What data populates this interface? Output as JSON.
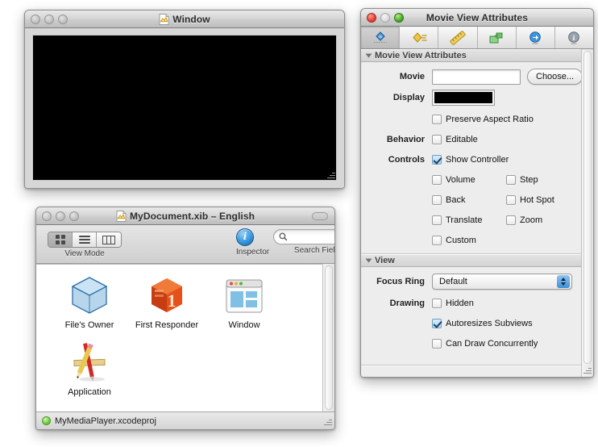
{
  "windows": {
    "canvas_window": {
      "title": "Window",
      "title_icon": "nib-document-icon",
      "content_color": "#000000",
      "traffic_lights": [
        "close-gray",
        "minimize-gray",
        "zoom-gray"
      ]
    },
    "xib_window": {
      "title": "MyDocument.xib – English",
      "title_icon": "nib-document-icon",
      "toolbar": {
        "view_mode_label": "View Mode",
        "view_mode_options": [
          "icon-view",
          "list-view",
          "column-view"
        ],
        "view_mode_selected": "icon-view",
        "inspector_label": "Inspector",
        "inspector_icon": "info-circle-icon",
        "search_label": "Search Field",
        "search_placeholder": "",
        "search_value": "",
        "search_icon": "search-icon"
      },
      "objects": [
        {
          "label": "File's Owner",
          "icon": "blue-cube-icon"
        },
        {
          "label": "First Responder",
          "icon": "orange-cube-one-icon"
        },
        {
          "label": "Window",
          "icon": "window-icon"
        },
        {
          "label": "Application",
          "icon": "xcode-hammer-ruler-icon"
        }
      ],
      "status": {
        "text": "MyMediaPlayer.xcodeproj",
        "dot": "green-status-dot",
        "dot_color": "#79cf49"
      }
    },
    "inspector": {
      "title": "Movie View Attributes",
      "traffic_lights": [
        "close-red",
        "minimize-disabled",
        "zoom-green"
      ],
      "tabs": [
        {
          "name": "attributes",
          "icon": "attributes-inspector-icon",
          "selected": true
        },
        {
          "name": "effects",
          "icon": "effects-inspector-icon",
          "selected": false
        },
        {
          "name": "size",
          "icon": "size-ruler-icon",
          "selected": false
        },
        {
          "name": "bindings",
          "icon": "bindings-icon",
          "selected": false
        },
        {
          "name": "connections",
          "icon": "blue-arrow-icon",
          "selected": false
        },
        {
          "name": "identity",
          "icon": "info-identity-icon",
          "selected": false
        }
      ],
      "sections": [
        {
          "header": "Movie View Attributes",
          "rows": [
            {
              "type": "textfield",
              "label": "Movie",
              "value": "",
              "button": "Choose..."
            },
            {
              "type": "colorwell",
              "label": "Display",
              "color": "#000000"
            },
            {
              "type": "checkbox",
              "label": "",
              "items": [
                {
                  "text": "Preserve Aspect Ratio",
                  "checked": false
                }
              ]
            },
            {
              "type": "checkbox",
              "label": "Behavior",
              "items": [
                {
                  "text": "Editable",
                  "checked": false
                }
              ]
            },
            {
              "type": "checkbox",
              "label": "Controls",
              "items": [
                {
                  "text": "Show Controller",
                  "checked": true
                }
              ]
            },
            {
              "type": "checkbox2",
              "label": "",
              "items": [
                {
                  "text": "Volume",
                  "checked": false
                },
                {
                  "text": "Step",
                  "checked": false
                }
              ]
            },
            {
              "type": "checkbox2",
              "label": "",
              "items": [
                {
                  "text": "Back",
                  "checked": false
                },
                {
                  "text": "Hot Spot",
                  "checked": false
                }
              ]
            },
            {
              "type": "checkbox2",
              "label": "",
              "items": [
                {
                  "text": "Translate",
                  "checked": false
                },
                {
                  "text": "Zoom",
                  "checked": false
                }
              ]
            },
            {
              "type": "checkbox",
              "label": "",
              "items": [
                {
                  "text": "Custom",
                  "checked": false
                }
              ]
            }
          ]
        },
        {
          "header": "View",
          "rows": [
            {
              "type": "popup",
              "label": "Focus Ring",
              "value": "Default"
            },
            {
              "type": "checkbox",
              "label": "Drawing",
              "items": [
                {
                  "text": "Hidden",
                  "checked": false
                }
              ]
            },
            {
              "type": "checkbox",
              "label": "",
              "items": [
                {
                  "text": "Autoresizes Subviews",
                  "checked": true
                }
              ]
            },
            {
              "type": "checkbox",
              "label": "",
              "items": [
                {
                  "text": "Can Draw Concurrently",
                  "checked": false
                }
              ]
            }
          ]
        }
      ]
    }
  }
}
